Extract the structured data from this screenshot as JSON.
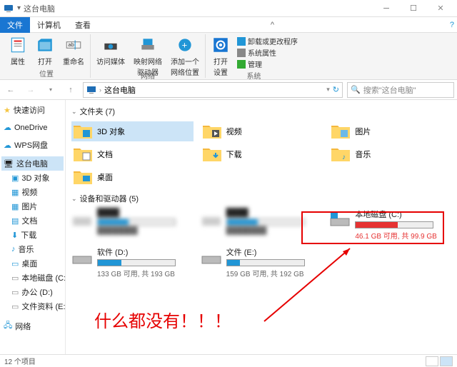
{
  "window": {
    "title": "这台电脑"
  },
  "menubar": {
    "file": "文件",
    "computer": "计算机",
    "view": "查看"
  },
  "ribbon": {
    "loc_group": "位置",
    "net_group": "网络",
    "sys_group": "系统",
    "props": "属性",
    "open": "打开",
    "rename": "重命名",
    "access_media": "访问媒体",
    "map_drive": "映射网络\n驱动器",
    "add_net": "添加一个\n网络位置",
    "open_settings": "打开\n设置",
    "uninstall": "卸载或更改程序",
    "sys_props": "系统属性",
    "manage": "管理"
  },
  "nav": {
    "breadcrumb": "这台电脑",
    "search_placeholder": "搜索\"这台电脑\""
  },
  "sidebar": {
    "quick": "快速访问",
    "onedrive": "OneDrive",
    "wps": "WPS网盘",
    "thispc": "这台电脑",
    "3d": "3D 对象",
    "video": "视频",
    "pictures": "图片",
    "docs": "文档",
    "downloads": "下载",
    "music": "音乐",
    "desktop": "桌面",
    "localc": "本地磁盘 (C:)",
    "office": "办公 (D:)",
    "docdrive": "文件资料 (E:)",
    "network": "网络"
  },
  "sections": {
    "folders": "文件夹 (7)",
    "drives": "设备和驱动器 (5)"
  },
  "folders": {
    "3d": "3D 对象",
    "video": "视频",
    "pictures": "图片",
    "docs": "文档",
    "downloads": "下载",
    "music": "音乐",
    "desktop": "桌面"
  },
  "drives": {
    "localc": {
      "name": "本地磁盘 (C:)",
      "text": "46.1 GB 可用, 共 99.9 GB",
      "fill": 54,
      "red": true
    },
    "soft": {
      "name": "软件 (D:)",
      "text": "133 GB 可用, 共 193 GB",
      "fill": 31
    },
    "docdrive": {
      "name": "文件 (E:)",
      "text": "159 GB 可用, 共 192 GB",
      "fill": 17
    }
  },
  "annotation": {
    "text": "什么都没有！！！"
  },
  "status": {
    "count": "12 个项目"
  }
}
